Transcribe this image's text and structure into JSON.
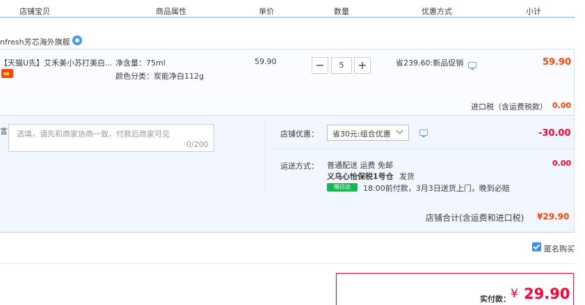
{
  "header": {
    "col_shop_item": "店铺宝贝",
    "col_props": "商品属性",
    "col_price": "单价",
    "col_qty": "数量",
    "col_discount": "优惠方式",
    "col_subtotal": "小计"
  },
  "shop": {
    "name": "nfresh芳芯海外旗舰"
  },
  "item": {
    "title": "【天猫U先】艾禾美小苏打美白...",
    "prop_volume": "净含量：75ml",
    "prop_color": "颜色分类：炭能净白112g",
    "unit_price": "59.90",
    "quantity": "5",
    "minus_label": "−",
    "plus_label": "+",
    "promo": "省239.60:新品促销",
    "subtotal": "59.90"
  },
  "tax": {
    "label": "进口税（含运费税款）",
    "value": "0.00"
  },
  "message": {
    "label": "言",
    "placeholder": "选填，请先和商家协商一致，付款后商家可见",
    "counter": "0/200"
  },
  "store_discount": {
    "label": "店铺优惠：",
    "selected": "省30元:组合优惠",
    "value": "-30.00"
  },
  "shipping": {
    "label": "运送方式：",
    "method": "普通配送 运费 免邮",
    "warehouse": "义乌心怡保税1号仓",
    "dispatch": "发货",
    "badge": "隔日达",
    "note": "18:00前付款，3月3日送货上门，晚到必赔",
    "fee": "0.00"
  },
  "store_total": {
    "label": "店铺合计(含运费和进口税)",
    "value": "¥29.90"
  },
  "anonymous": {
    "label": "匿名购买",
    "checked": true
  },
  "payment": {
    "label": "实付款：",
    "currency": "¥",
    "value": "29.90"
  },
  "colors": {
    "accent_blue": "#3d8df5",
    "price_orange": "#ff4400",
    "pay_red": "#ff0036",
    "header_line": "#b2d1ff"
  }
}
